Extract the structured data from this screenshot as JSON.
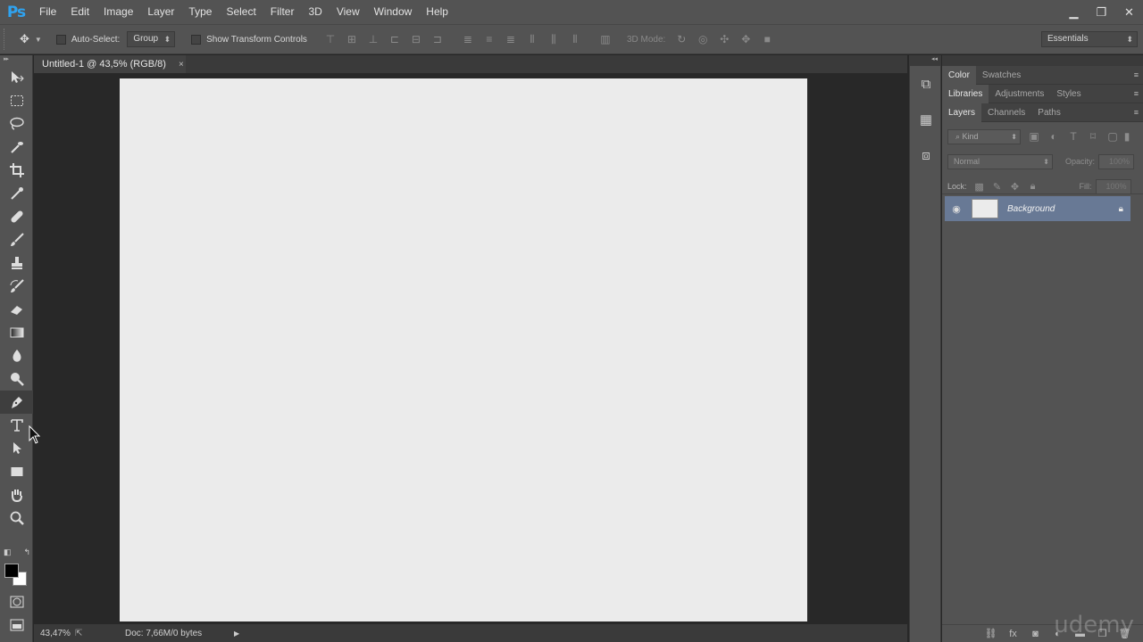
{
  "app": {
    "logo": "Ps"
  },
  "menu": [
    "File",
    "Edit",
    "Image",
    "Layer",
    "Type",
    "Select",
    "Filter",
    "3D",
    "View",
    "Window",
    "Help"
  ],
  "window_controls": {
    "minimize": "▁",
    "restore": "❐",
    "close": "✕"
  },
  "options_bar": {
    "auto_select_label": "Auto-Select:",
    "auto_select_value": "Group",
    "show_transform_label": "Show Transform Controls",
    "mode_3d_label": "3D Mode:",
    "workspace": "Essentials"
  },
  "document": {
    "tab_title": "Untitled-1 @ 43,5% (RGB/8)",
    "close_glyph": "×",
    "canvas_color": "#ebebeb"
  },
  "status_bar": {
    "zoom": "43,47%",
    "doc_size": "Doc: 7,66M/0 bytes",
    "menu_arrow": "▶"
  },
  "panels": {
    "color_tabs": [
      "Color",
      "Swatches"
    ],
    "library_tabs": [
      "Libraries",
      "Adjustments",
      "Styles"
    ],
    "layers_tabs": [
      "Layers",
      "Channels",
      "Paths"
    ],
    "filter_kind": "Kind",
    "blend_mode": "Normal",
    "opacity_label": "Opacity:",
    "opacity_value": "100%",
    "lock_label": "Lock:",
    "fill_label": "Fill:",
    "fill_value": "100%",
    "menu_glyph": "≡"
  },
  "layers": [
    {
      "name": "Background",
      "visible": true,
      "locked": true,
      "selected": true
    }
  ],
  "watermark": "udemy",
  "colors": {
    "accent": "#2fa3f0",
    "ui_bg": "#535353",
    "selected_layer": "#687995"
  }
}
